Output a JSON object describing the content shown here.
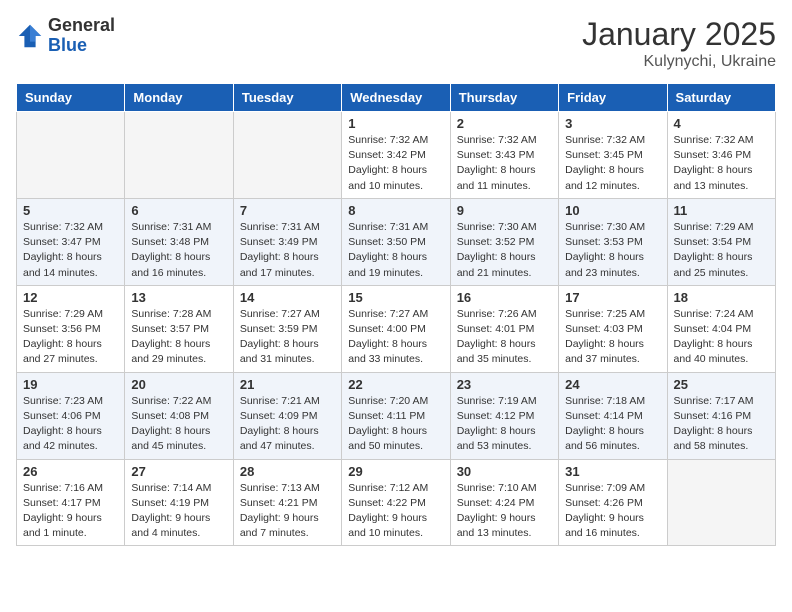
{
  "logo": {
    "general": "General",
    "blue": "Blue"
  },
  "title": {
    "month_year": "January 2025",
    "location": "Kulynychi, Ukraine"
  },
  "weekdays": [
    "Sunday",
    "Monday",
    "Tuesday",
    "Wednesday",
    "Thursday",
    "Friday",
    "Saturday"
  ],
  "weeks": [
    [
      {
        "day": "",
        "info": ""
      },
      {
        "day": "",
        "info": ""
      },
      {
        "day": "",
        "info": ""
      },
      {
        "day": "1",
        "info": "Sunrise: 7:32 AM\nSunset: 3:42 PM\nDaylight: 8 hours\nand 10 minutes."
      },
      {
        "day": "2",
        "info": "Sunrise: 7:32 AM\nSunset: 3:43 PM\nDaylight: 8 hours\nand 11 minutes."
      },
      {
        "day": "3",
        "info": "Sunrise: 7:32 AM\nSunset: 3:45 PM\nDaylight: 8 hours\nand 12 minutes."
      },
      {
        "day": "4",
        "info": "Sunrise: 7:32 AM\nSunset: 3:46 PM\nDaylight: 8 hours\nand 13 minutes."
      }
    ],
    [
      {
        "day": "5",
        "info": "Sunrise: 7:32 AM\nSunset: 3:47 PM\nDaylight: 8 hours\nand 14 minutes."
      },
      {
        "day": "6",
        "info": "Sunrise: 7:31 AM\nSunset: 3:48 PM\nDaylight: 8 hours\nand 16 minutes."
      },
      {
        "day": "7",
        "info": "Sunrise: 7:31 AM\nSunset: 3:49 PM\nDaylight: 8 hours\nand 17 minutes."
      },
      {
        "day": "8",
        "info": "Sunrise: 7:31 AM\nSunset: 3:50 PM\nDaylight: 8 hours\nand 19 minutes."
      },
      {
        "day": "9",
        "info": "Sunrise: 7:30 AM\nSunset: 3:52 PM\nDaylight: 8 hours\nand 21 minutes."
      },
      {
        "day": "10",
        "info": "Sunrise: 7:30 AM\nSunset: 3:53 PM\nDaylight: 8 hours\nand 23 minutes."
      },
      {
        "day": "11",
        "info": "Sunrise: 7:29 AM\nSunset: 3:54 PM\nDaylight: 8 hours\nand 25 minutes."
      }
    ],
    [
      {
        "day": "12",
        "info": "Sunrise: 7:29 AM\nSunset: 3:56 PM\nDaylight: 8 hours\nand 27 minutes."
      },
      {
        "day": "13",
        "info": "Sunrise: 7:28 AM\nSunset: 3:57 PM\nDaylight: 8 hours\nand 29 minutes."
      },
      {
        "day": "14",
        "info": "Sunrise: 7:27 AM\nSunset: 3:59 PM\nDaylight: 8 hours\nand 31 minutes."
      },
      {
        "day": "15",
        "info": "Sunrise: 7:27 AM\nSunset: 4:00 PM\nDaylight: 8 hours\nand 33 minutes."
      },
      {
        "day": "16",
        "info": "Sunrise: 7:26 AM\nSunset: 4:01 PM\nDaylight: 8 hours\nand 35 minutes."
      },
      {
        "day": "17",
        "info": "Sunrise: 7:25 AM\nSunset: 4:03 PM\nDaylight: 8 hours\nand 37 minutes."
      },
      {
        "day": "18",
        "info": "Sunrise: 7:24 AM\nSunset: 4:04 PM\nDaylight: 8 hours\nand 40 minutes."
      }
    ],
    [
      {
        "day": "19",
        "info": "Sunrise: 7:23 AM\nSunset: 4:06 PM\nDaylight: 8 hours\nand 42 minutes."
      },
      {
        "day": "20",
        "info": "Sunrise: 7:22 AM\nSunset: 4:08 PM\nDaylight: 8 hours\nand 45 minutes."
      },
      {
        "day": "21",
        "info": "Sunrise: 7:21 AM\nSunset: 4:09 PM\nDaylight: 8 hours\nand 47 minutes."
      },
      {
        "day": "22",
        "info": "Sunrise: 7:20 AM\nSunset: 4:11 PM\nDaylight: 8 hours\nand 50 minutes."
      },
      {
        "day": "23",
        "info": "Sunrise: 7:19 AM\nSunset: 4:12 PM\nDaylight: 8 hours\nand 53 minutes."
      },
      {
        "day": "24",
        "info": "Sunrise: 7:18 AM\nSunset: 4:14 PM\nDaylight: 8 hours\nand 56 minutes."
      },
      {
        "day": "25",
        "info": "Sunrise: 7:17 AM\nSunset: 4:16 PM\nDaylight: 8 hours\nand 58 minutes."
      }
    ],
    [
      {
        "day": "26",
        "info": "Sunrise: 7:16 AM\nSunset: 4:17 PM\nDaylight: 9 hours\nand 1 minute."
      },
      {
        "day": "27",
        "info": "Sunrise: 7:14 AM\nSunset: 4:19 PM\nDaylight: 9 hours\nand 4 minutes."
      },
      {
        "day": "28",
        "info": "Sunrise: 7:13 AM\nSunset: 4:21 PM\nDaylight: 9 hours\nand 7 minutes."
      },
      {
        "day": "29",
        "info": "Sunrise: 7:12 AM\nSunset: 4:22 PM\nDaylight: 9 hours\nand 10 minutes."
      },
      {
        "day": "30",
        "info": "Sunrise: 7:10 AM\nSunset: 4:24 PM\nDaylight: 9 hours\nand 13 minutes."
      },
      {
        "day": "31",
        "info": "Sunrise: 7:09 AM\nSunset: 4:26 PM\nDaylight: 9 hours\nand 16 minutes."
      },
      {
        "day": "",
        "info": ""
      }
    ]
  ]
}
